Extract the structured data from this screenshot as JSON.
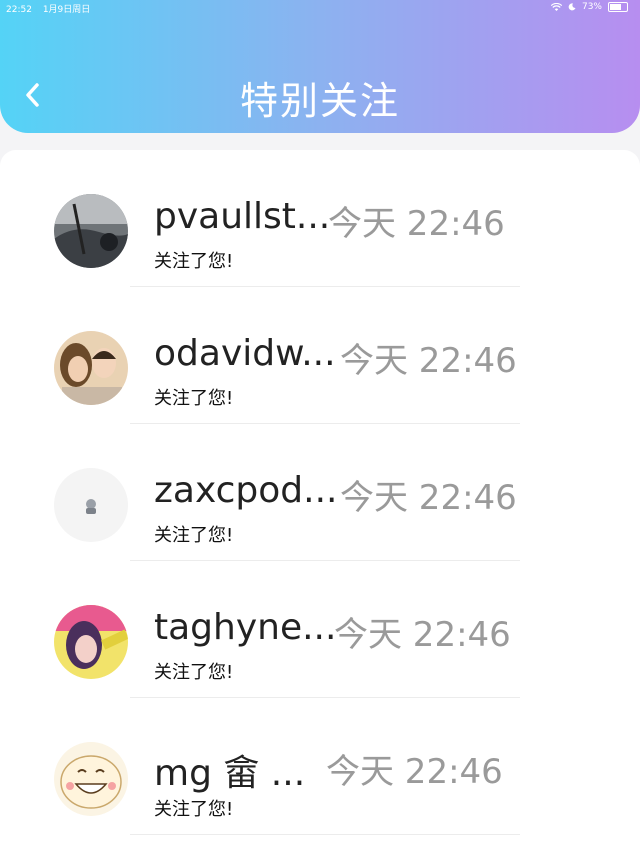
{
  "status_bar": {
    "time": "22:52",
    "date": "1月9日周日",
    "battery": "73%"
  },
  "header": {
    "title": "特别关注",
    "back_icon": "chevron-left-icon"
  },
  "notifications": [
    {
      "name": "pvaullst...",
      "time": "今天 22:46",
      "message": "关注了您!"
    },
    {
      "name": "odavidw...",
      "time": "今天 22:46",
      "message": "关注了您!"
    },
    {
      "name": "zaxcpod...",
      "time": "今天 22:46",
      "message": "关注了您!"
    },
    {
      "name": "taghyne...",
      "time": "今天 22:46",
      "message": "关注了您!"
    },
    {
      "name": "mg 畲 ...",
      "time": "今天 22:46",
      "message": "关注了您!"
    }
  ],
  "colors": {
    "gradient_start": "#54d3f6",
    "gradient_end": "#b78ef0",
    "time_gray": "#9a9a9a"
  }
}
